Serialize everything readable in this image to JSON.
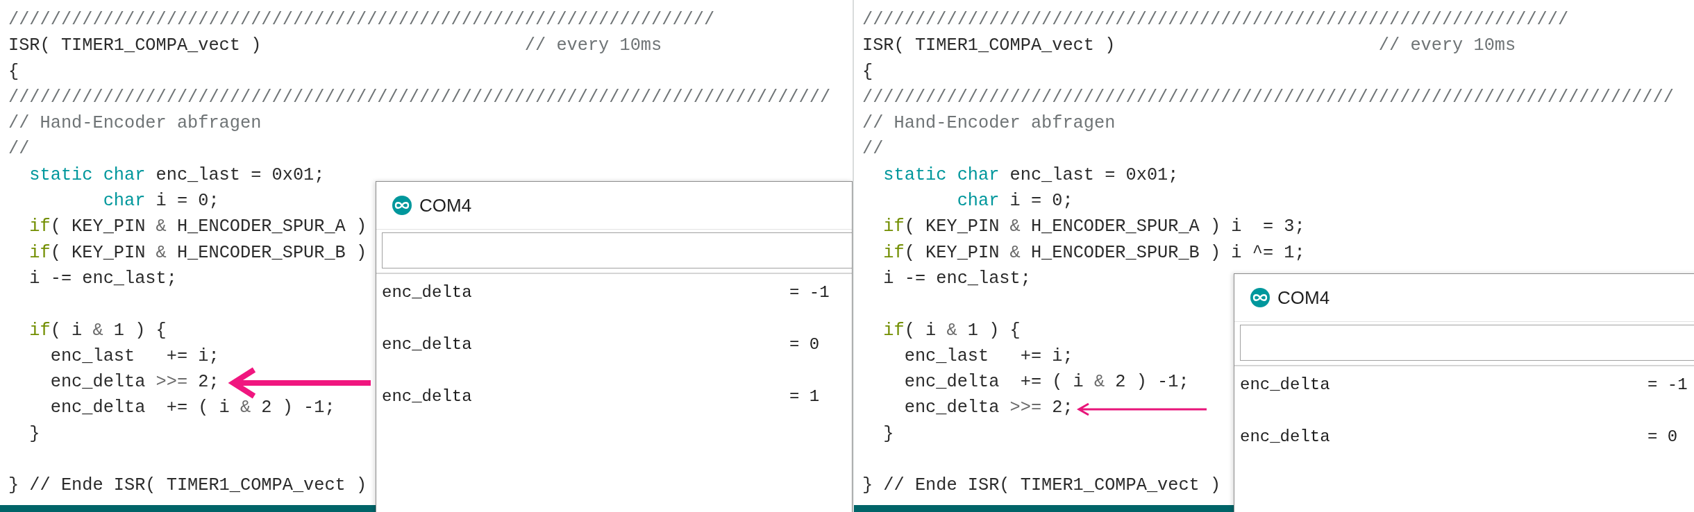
{
  "panels": [
    {
      "code_lines": [
        {
          "kind": "code",
          "tokens": [
            {
              "kind": "comment",
              "text": "///////////////////////////////////////////////////////////////////"
            }
          ]
        },
        {
          "kind": "code",
          "tokens": [
            {
              "kind": "plain",
              "text": "ISR( TIMER1_COMPA_vect )"
            },
            {
              "kind": "comment",
              "text": "                         // every 10ms"
            }
          ]
        },
        {
          "kind": "code",
          "tokens": [
            {
              "kind": "plain",
              "text": "{"
            }
          ]
        },
        {
          "kind": "code",
          "tokens": [
            {
              "kind": "comment",
              "text": "//////////////////////////////////////////////////////////////////////////////"
            }
          ]
        },
        {
          "kind": "code",
          "tokens": [
            {
              "kind": "comment",
              "text": "// Hand-Encoder abfragen"
            }
          ]
        },
        {
          "kind": "code",
          "tokens": [
            {
              "kind": "comment",
              "text": "//"
            }
          ]
        },
        {
          "kind": "code",
          "tokens": [
            {
              "kind": "keyword",
              "text": "  static"
            },
            {
              "kind": "keyword",
              "text": " char"
            },
            {
              "kind": "plain",
              "text": " enc_last = 0x01;"
            }
          ]
        },
        {
          "kind": "code",
          "tokens": [
            {
              "kind": "keyword",
              "text": "         char"
            },
            {
              "kind": "plain",
              "text": " i = 0;"
            }
          ]
        },
        {
          "kind": "code",
          "tokens": [
            {
              "kind": "control",
              "text": "  if"
            },
            {
              "kind": "plain",
              "text": "( KEY_PIN "
            },
            {
              "kind": "operator",
              "text": "&"
            },
            {
              "kind": "plain",
              "text": " H_ENCODER_SPUR_A )"
            }
          ]
        },
        {
          "kind": "code",
          "tokens": [
            {
              "kind": "control",
              "text": "  if"
            },
            {
              "kind": "plain",
              "text": "( KEY_PIN "
            },
            {
              "kind": "operator",
              "text": "&"
            },
            {
              "kind": "plain",
              "text": " H_ENCODER_SPUR_B )"
            }
          ]
        },
        {
          "kind": "code",
          "tokens": [
            {
              "kind": "plain",
              "text": "  i -= enc_last;"
            }
          ]
        },
        {
          "kind": "blank"
        },
        {
          "kind": "code",
          "tokens": [
            {
              "kind": "control",
              "text": "  if"
            },
            {
              "kind": "plain",
              "text": "( i "
            },
            {
              "kind": "operator",
              "text": "&"
            },
            {
              "kind": "plain",
              "text": " 1 ) {"
            }
          ]
        },
        {
          "kind": "code",
          "tokens": [
            {
              "kind": "plain",
              "text": "    enc_last   += i;"
            }
          ]
        },
        {
          "kind": "code",
          "tokens": [
            {
              "kind": "plain",
              "text": "    enc_delta "
            },
            {
              "kind": "operator",
              "text": ">>="
            },
            {
              "kind": "plain",
              "text": " 2;"
            }
          ]
        },
        {
          "kind": "code",
          "tokens": [
            {
              "kind": "plain",
              "text": "    enc_delta  += ( i "
            },
            {
              "kind": "operator",
              "text": "&"
            },
            {
              "kind": "plain",
              "text": " 2 ) -1;"
            }
          ]
        },
        {
          "kind": "code",
          "tokens": [
            {
              "kind": "plain",
              "text": "  }"
            }
          ]
        },
        {
          "kind": "blank"
        },
        {
          "kind": "code",
          "tokens": [
            {
              "kind": "plain",
              "text": "} // Ende ISR( TIMER1_COMPA_vect )"
            }
          ]
        }
      ],
      "serial_monitor": {
        "title": "COM4",
        "output": [
          {
            "label": "enc_delta",
            "value": "= -1"
          },
          {
            "label": "enc_delta",
            "value": "= 0"
          },
          {
            "label": "enc_delta",
            "value": "= 1"
          }
        ]
      }
    },
    {
      "code_lines": [
        {
          "kind": "code",
          "tokens": [
            {
              "kind": "comment",
              "text": "///////////////////////////////////////////////////////////////////"
            }
          ]
        },
        {
          "kind": "code",
          "tokens": [
            {
              "kind": "plain",
              "text": "ISR( TIMER1_COMPA_vect )"
            },
            {
              "kind": "comment",
              "text": "                         // every 10ms"
            }
          ]
        },
        {
          "kind": "code",
          "tokens": [
            {
              "kind": "plain",
              "text": "{"
            }
          ]
        },
        {
          "kind": "code",
          "tokens": [
            {
              "kind": "comment",
              "text": "/////////////////////////////////////////////////////////////////////////////"
            }
          ]
        },
        {
          "kind": "code",
          "tokens": [
            {
              "kind": "comment",
              "text": "// Hand-Encoder abfragen"
            }
          ]
        },
        {
          "kind": "code",
          "tokens": [
            {
              "kind": "comment",
              "text": "//"
            }
          ]
        },
        {
          "kind": "code",
          "tokens": [
            {
              "kind": "keyword",
              "text": "  static"
            },
            {
              "kind": "keyword",
              "text": " char"
            },
            {
              "kind": "plain",
              "text": " enc_last = 0x01;"
            }
          ]
        },
        {
          "kind": "code",
          "tokens": [
            {
              "kind": "keyword",
              "text": "         char"
            },
            {
              "kind": "plain",
              "text": " i = 0;"
            }
          ]
        },
        {
          "kind": "code",
          "tokens": [
            {
              "kind": "control",
              "text": "  if"
            },
            {
              "kind": "plain",
              "text": "( KEY_PIN "
            },
            {
              "kind": "operator",
              "text": "&"
            },
            {
              "kind": "plain",
              "text": " H_ENCODER_SPUR_A ) i  = 3;"
            }
          ]
        },
        {
          "kind": "code",
          "tokens": [
            {
              "kind": "control",
              "text": "  if"
            },
            {
              "kind": "plain",
              "text": "( KEY_PIN "
            },
            {
              "kind": "operator",
              "text": "&"
            },
            {
              "kind": "plain",
              "text": " H_ENCODER_SPUR_B ) i ^= 1;"
            }
          ]
        },
        {
          "kind": "code",
          "tokens": [
            {
              "kind": "plain",
              "text": "  i -= enc_last;"
            }
          ]
        },
        {
          "kind": "blank"
        },
        {
          "kind": "code",
          "tokens": [
            {
              "kind": "control",
              "text": "  if"
            },
            {
              "kind": "plain",
              "text": "( i "
            },
            {
              "kind": "operator",
              "text": "&"
            },
            {
              "kind": "plain",
              "text": " 1 ) {"
            }
          ]
        },
        {
          "kind": "code",
          "tokens": [
            {
              "kind": "plain",
              "text": "    enc_last   += i;"
            }
          ]
        },
        {
          "kind": "code",
          "tokens": [
            {
              "kind": "plain",
              "text": "    enc_delta  += ( i "
            },
            {
              "kind": "operator",
              "text": "&"
            },
            {
              "kind": "plain",
              "text": " 2 ) -1;"
            }
          ]
        },
        {
          "kind": "code",
          "tokens": [
            {
              "kind": "plain",
              "text": "    enc_delta "
            },
            {
              "kind": "operator",
              "text": ">>="
            },
            {
              "kind": "plain",
              "text": " 2;"
            }
          ]
        },
        {
          "kind": "code",
          "tokens": [
            {
              "kind": "plain",
              "text": "  }"
            }
          ]
        },
        {
          "kind": "blank"
        },
        {
          "kind": "code",
          "tokens": [
            {
              "kind": "plain",
              "text": "} // Ende ISR( TIMER1_COMPA_vect )"
            }
          ]
        }
      ],
      "serial_monitor": {
        "title": "COM4",
        "output": [
          {
            "label": "enc_delta",
            "value": "= -1"
          },
          {
            "label": "enc_delta",
            "value": "= 0"
          }
        ]
      }
    }
  ]
}
